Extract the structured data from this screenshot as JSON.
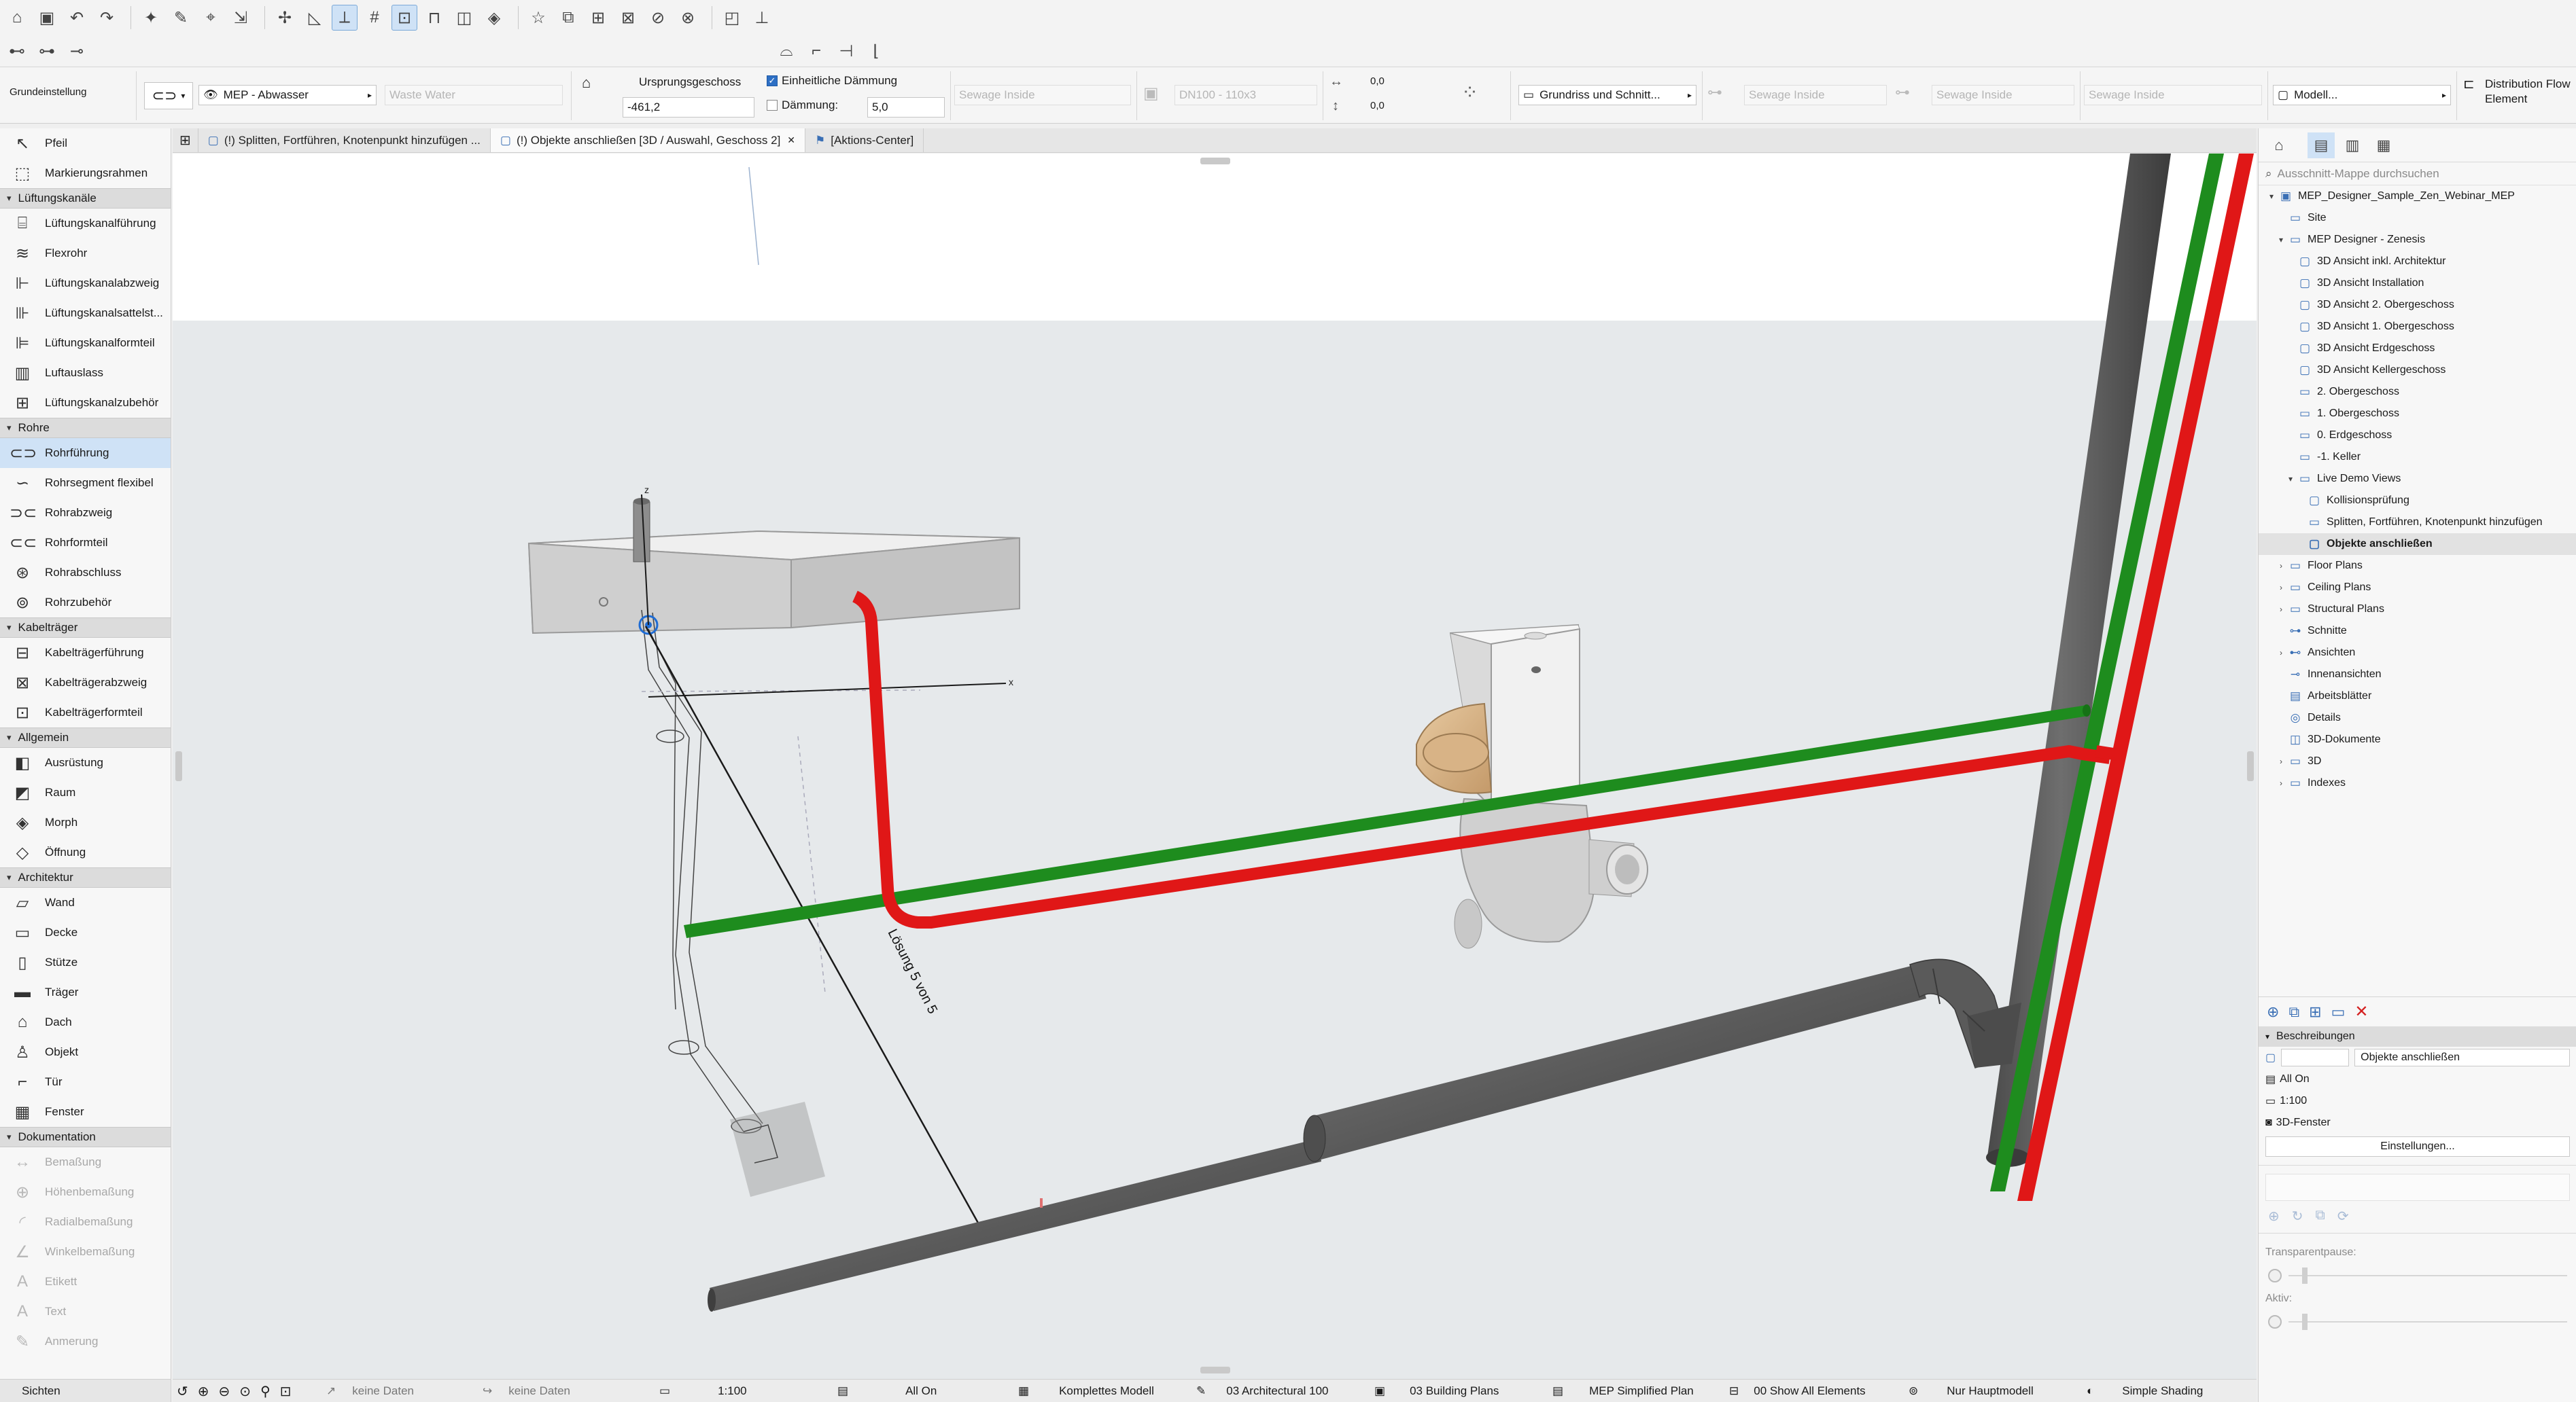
{
  "toolbar": {
    "row1_icons": [
      "home-icon",
      "save-icon",
      "undo-icon",
      "redo-icon",
      "magic-wand-icon",
      "pencil-icon",
      "eyedropper-icon",
      "pick-icon",
      "cursor-icon",
      "snap-icon",
      "guide-icon",
      "grid-icon",
      "selection-icon",
      "lock-icon",
      "layer-icon",
      "group-icon",
      "favorites-star-icon",
      "trace-icon",
      "renovation-icon",
      "teamwork-icon",
      "reserve-icon",
      "markup-icon",
      "walls-icon",
      "pin-icon"
    ],
    "row2_icons": [
      "dimension-icon",
      "section-icon",
      "level-icon",
      "mep-route-icon",
      "connect-icon",
      "branch-icon",
      "elbow-icon"
    ]
  },
  "infobox": {
    "settings_label": "Grundeinstellung",
    "layer_value": "MEP - Abwasser",
    "system_value": "Waste Water",
    "origin_floor_label": "Ursprungsgeschoss",
    "origin_floor_value": "-461,2",
    "insulation_uniform_label": "Einheitliche Dämmung",
    "insulation_label": "Dämmung:",
    "insulation_value": "5,0",
    "sewage1": "Sewage Inside",
    "dn_value": "DN100 - 110x3",
    "offset_x": "0,0",
    "offset_y": "0,0",
    "view_dropdown": "Grundriss und Schnitt...",
    "sewage2": "Sewage Inside",
    "sewage3": "Sewage Inside",
    "sewage4": "Sewage Inside",
    "model_dropdown": "Modell...",
    "right_label": "Distribution Flow Element"
  },
  "tabs": [
    {
      "label": "(!) Splitten, Fortführen, Knotenpunkt hinzufügen ...",
      "active": false
    },
    {
      "label": "(!) Objekte anschließen [3D / Auswahl, Geschoss 2]",
      "active": true
    },
    {
      "label": "[Aktions-Center]",
      "active": false
    }
  ],
  "palette": {
    "top_items": [
      {
        "label": "Pfeil",
        "icon": "arrow-icon"
      },
      {
        "label": "Markierungsrahmen",
        "icon": "marquee-icon"
      }
    ],
    "sections": [
      {
        "title": "Lüftungskanäle",
        "items": [
          {
            "label": "Lüftungskanalführung",
            "icon": "duct-route-icon"
          },
          {
            "label": "Flexrohr",
            "icon": "flex-duct-icon"
          },
          {
            "label": "Lüftungskanalabzweig",
            "icon": "duct-branch-icon"
          },
          {
            "label": "Lüftungskanalsattelst...",
            "icon": "duct-saddle-icon"
          },
          {
            "label": "Lüftungskanalformteil",
            "icon": "duct-fitting-icon"
          },
          {
            "label": "Luftauslass",
            "icon": "air-outlet-icon"
          },
          {
            "label": "Lüftungskanalzubehör",
            "icon": "duct-accessory-icon"
          }
        ]
      },
      {
        "title": "Rohre",
        "items": [
          {
            "label": "Rohrführung",
            "icon": "pipe-route-icon",
            "selected": true
          },
          {
            "label": "Rohrsegment flexibel",
            "icon": "flex-pipe-icon"
          },
          {
            "label": "Rohrabzweig",
            "icon": "pipe-branch-icon"
          },
          {
            "label": "Rohrformteil",
            "icon": "pipe-fitting-icon"
          },
          {
            "label": "Rohrabschluss",
            "icon": "pipe-terminal-icon"
          },
          {
            "label": "Rohrzubehör",
            "icon": "pipe-accessory-icon"
          }
        ]
      },
      {
        "title": "Kabelträger",
        "items": [
          {
            "label": "Kabelträgerführung",
            "icon": "cable-tray-route-icon"
          },
          {
            "label": "Kabelträgerabzweig",
            "icon": "cable-tray-branch-icon"
          },
          {
            "label": "Kabelträgerformteil",
            "icon": "cable-tray-fitting-icon"
          }
        ]
      },
      {
        "title": "Allgemein",
        "items": [
          {
            "label": "Ausrüstung",
            "icon": "equipment-icon"
          },
          {
            "label": "Raum",
            "icon": "zone-icon"
          },
          {
            "label": "Morph",
            "icon": "morph-icon"
          },
          {
            "label": "Öffnung",
            "icon": "opening-icon"
          }
        ]
      },
      {
        "title": "Architektur",
        "items": [
          {
            "label": "Wand",
            "icon": "wall-icon"
          },
          {
            "label": "Decke",
            "icon": "slab-icon"
          },
          {
            "label": "Stütze",
            "icon": "column-icon"
          },
          {
            "label": "Träger",
            "icon": "beam-icon"
          },
          {
            "label": "Dach",
            "icon": "roof-icon"
          },
          {
            "label": "Objekt",
            "icon": "object-icon"
          },
          {
            "label": "Tür",
            "icon": "door-icon"
          },
          {
            "label": "Fenster",
            "icon": "window-icon"
          }
        ]
      },
      {
        "title": "Dokumentation",
        "items": [
          {
            "label": "Bemaßung",
            "icon": "dimension-icon",
            "disabled": true
          },
          {
            "label": "Höhenbemaßung",
            "icon": "level-dimension-icon",
            "disabled": true
          },
          {
            "label": "Radialbemaßung",
            "icon": "radial-dimension-icon",
            "disabled": true
          },
          {
            "label": "Winkelbemaßung",
            "icon": "angle-dimension-icon",
            "disabled": true
          },
          {
            "label": "Etikett",
            "icon": "label-icon",
            "disabled": true
          },
          {
            "label": "Text",
            "icon": "text-icon",
            "disabled": true
          },
          {
            "label": "Anmerung",
            "icon": "annotation-icon",
            "disabled": true
          }
        ]
      }
    ],
    "footer": "Sichten"
  },
  "viewport": {
    "solution_text": "Lösung 5 von 5",
    "axis_z": "z",
    "axis_x": "x",
    "colors": {
      "green": "#1e8c1e",
      "red": "#e01717",
      "pipe_gray": "#5f5f5f",
      "sky": "#ffffff",
      "ground": "#e6e9eb"
    }
  },
  "navigator": {
    "search_placeholder": "Ausschnitt-Mappe durchsuchen",
    "tree": [
      {
        "label": "MEP_Designer_Sample_Zen_Webinar_MEP",
        "level": 0,
        "twisty": "▾",
        "icon": "project-icon"
      },
      {
        "label": "Site",
        "level": 1,
        "twisty": "",
        "icon": "view-icon"
      },
      {
        "label": "MEP Designer - Zenesis",
        "level": 1,
        "twisty": "▾",
        "icon": "folder-icon"
      },
      {
        "label": "3D Ansicht inkl. Architektur",
        "level": 2,
        "twisty": "",
        "icon": "3d-view-icon"
      },
      {
        "label": "3D Ansicht Installation",
        "level": 2,
        "twisty": "",
        "icon": "3d-view-icon"
      },
      {
        "label": "3D Ansicht 2. Obergeschoss",
        "level": 2,
        "twisty": "",
        "icon": "3d-view-icon"
      },
      {
        "label": "3D Ansicht 1. Obergeschoss",
        "level": 2,
        "twisty": "",
        "icon": "3d-view-icon"
      },
      {
        "label": "3D Ansicht Erdgeschoss",
        "level": 2,
        "twisty": "",
        "icon": "3d-view-icon"
      },
      {
        "label": "3D Ansicht Kellergeschoss",
        "level": 2,
        "twisty": "",
        "icon": "3d-view-icon"
      },
      {
        "label": "2. Obergeschoss",
        "level": 2,
        "twisty": "",
        "icon": "floorplan-icon"
      },
      {
        "label": "1. Obergeschoss",
        "level": 2,
        "twisty": "",
        "icon": "floorplan-icon"
      },
      {
        "label": "0. Erdgeschoss",
        "level": 2,
        "twisty": "",
        "icon": "floorplan-icon"
      },
      {
        "label": "-1. Keller",
        "level": 2,
        "twisty": "",
        "icon": "floorplan-icon"
      },
      {
        "label": "Live Demo Views",
        "level": 2,
        "twisty": "▾",
        "icon": "folder-icon"
      },
      {
        "label": "Kollisionsprüfung",
        "level": 3,
        "twisty": "",
        "icon": "3d-view-icon"
      },
      {
        "label": "Splitten, Fortführen, Knotenpunkt hinzufügen",
        "level": 3,
        "twisty": "",
        "icon": "floorplan-icon"
      },
      {
        "label": "Objekte anschließen",
        "level": 3,
        "twisty": "",
        "icon": "3d-view-icon",
        "selected": true
      },
      {
        "label": "Floor Plans",
        "level": 1,
        "twisty": "›",
        "icon": "folder-icon"
      },
      {
        "label": "Ceiling Plans",
        "level": 1,
        "twisty": "›",
        "icon": "folder-icon"
      },
      {
        "label": "Structural Plans",
        "level": 1,
        "twisty": "›",
        "icon": "folder-icon"
      },
      {
        "label": "Schnitte",
        "level": 1,
        "twisty": "",
        "icon": "section-icon"
      },
      {
        "label": "Ansichten",
        "level": 1,
        "twisty": "›",
        "icon": "elevation-icon"
      },
      {
        "label": "Innenansichten",
        "level": 1,
        "twisty": "",
        "icon": "interior-elevation-icon"
      },
      {
        "label": "Arbeitsblätter",
        "level": 1,
        "twisty": "",
        "icon": "worksheet-icon"
      },
      {
        "label": "Details",
        "level": 1,
        "twisty": "",
        "icon": "detail-icon"
      },
      {
        "label": "3D-Dokumente",
        "level": 1,
        "twisty": "",
        "icon": "3d-document-icon"
      },
      {
        "label": "3D",
        "level": 1,
        "twisty": "›",
        "icon": "folder-icon"
      },
      {
        "label": "Indexes",
        "level": 1,
        "twisty": "›",
        "icon": "folder-icon"
      }
    ],
    "properties": {
      "section_title": "Beschreibungen",
      "name_value": "Objekte anschließen",
      "layer_combo": "All On",
      "scale": "1:100",
      "window_type": "3D-Fenster",
      "settings_button": "Einstellungen...",
      "transparent_label": "Transparentpause:",
      "active_label": "Aktiv:"
    }
  },
  "statusbar": {
    "no_data_1": "keine Daten",
    "no_data_2": "keine Daten",
    "scale": "1:100",
    "layer_combo": "All On",
    "model": "Komplettes Modell",
    "pen_set": "03 Architectural 100",
    "mvo": "03 Building Plans",
    "plan_type": "MEP Simplified Plan",
    "elements": "00 Show All Elements",
    "main_model": "Nur Hauptmodell",
    "shading": "Simple Shading"
  }
}
